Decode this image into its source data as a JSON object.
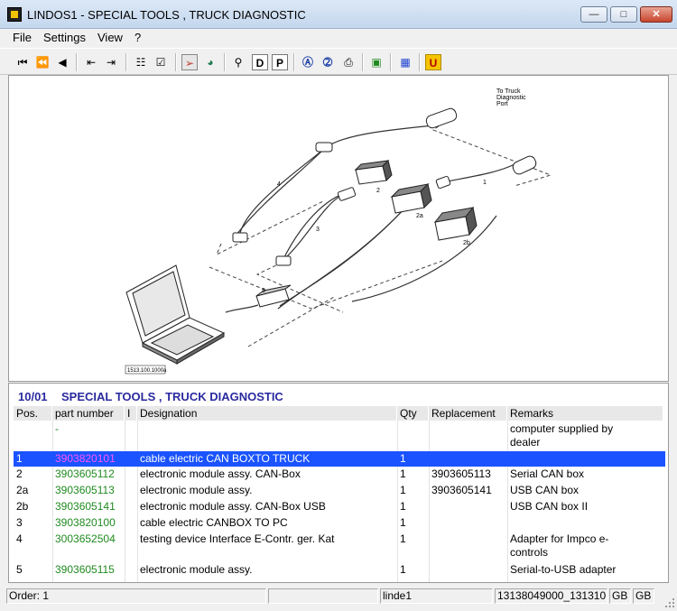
{
  "window": {
    "title": "LINDOS1 - SPECIAL TOOLS , TRUCK DIAGNOSTIC"
  },
  "menu": [
    "File",
    "Settings",
    "View",
    "?"
  ],
  "drawing": {
    "labels": {
      "port": [
        "To Truck",
        "Diagnostic",
        "Port"
      ],
      "c1": "1",
      "c2": "2",
      "c2a": "2a",
      "c2b": "2b",
      "c3": "3",
      "c4": "4",
      "c5": "5",
      "ref": "1513.100.1000a"
    }
  },
  "parts": {
    "heading_num": "10/01",
    "heading_title": "SPECIAL TOOLS , TRUCK DIAGNOSTIC",
    "columns": [
      "Pos.",
      "part number",
      "I",
      "Designation",
      "Qty",
      "Replacement",
      "Remarks"
    ],
    "rows": [
      {
        "pos": "",
        "pn": "-",
        "flag": "",
        "des": "",
        "qty": "",
        "rep": "",
        "rem": "computer supplied by dealer",
        "selected": false
      },
      {
        "pos": "1",
        "pn": "3903820101",
        "flag": "",
        "des": "cable electric CAN BOXTO TRUCK",
        "qty": "1",
        "rep": "",
        "rem": "",
        "selected": true
      },
      {
        "pos": "2",
        "pn": "3903605112",
        "flag": "",
        "des": "electronic module assy. CAN-Box",
        "qty": "1",
        "rep": "3903605113",
        "rem": "Serial CAN box",
        "selected": false
      },
      {
        "pos": "2a",
        "pn": "3903605113",
        "flag": "",
        "des": "electronic module assy.",
        "qty": "1",
        "rep": "3903605141",
        "rem": "USB CAN box",
        "selected": false
      },
      {
        "pos": "2b",
        "pn": "3903605141",
        "flag": "",
        "des": "electronic module assy. CAN-Box USB",
        "qty": "1",
        "rep": "",
        "rem": "USB CAN box II",
        "selected": false
      },
      {
        "pos": "3",
        "pn": "3903820100",
        "flag": "",
        "des": "cable electric CANBOX TO PC",
        "qty": "1",
        "rep": "",
        "rem": "",
        "selected": false
      },
      {
        "pos": "4",
        "pn": "3003652504",
        "flag": "",
        "des": "testing device Interface E-Contr. ger. Kat",
        "qty": "1",
        "rep": "",
        "rem": "Adapter for Impco e-controls",
        "selected": false
      },
      {
        "pos": "5",
        "pn": "3903605115",
        "flag": "",
        "des": "electronic module assy.",
        "qty": "1",
        "rep": "",
        "rem": "Serial-to-USB adapter",
        "selected": false
      }
    ]
  },
  "status": {
    "order": "Order: 1",
    "empty": "",
    "user": "linde1",
    "code": "13138049000_131310",
    "lang1": "GB",
    "lang2": "GB"
  }
}
